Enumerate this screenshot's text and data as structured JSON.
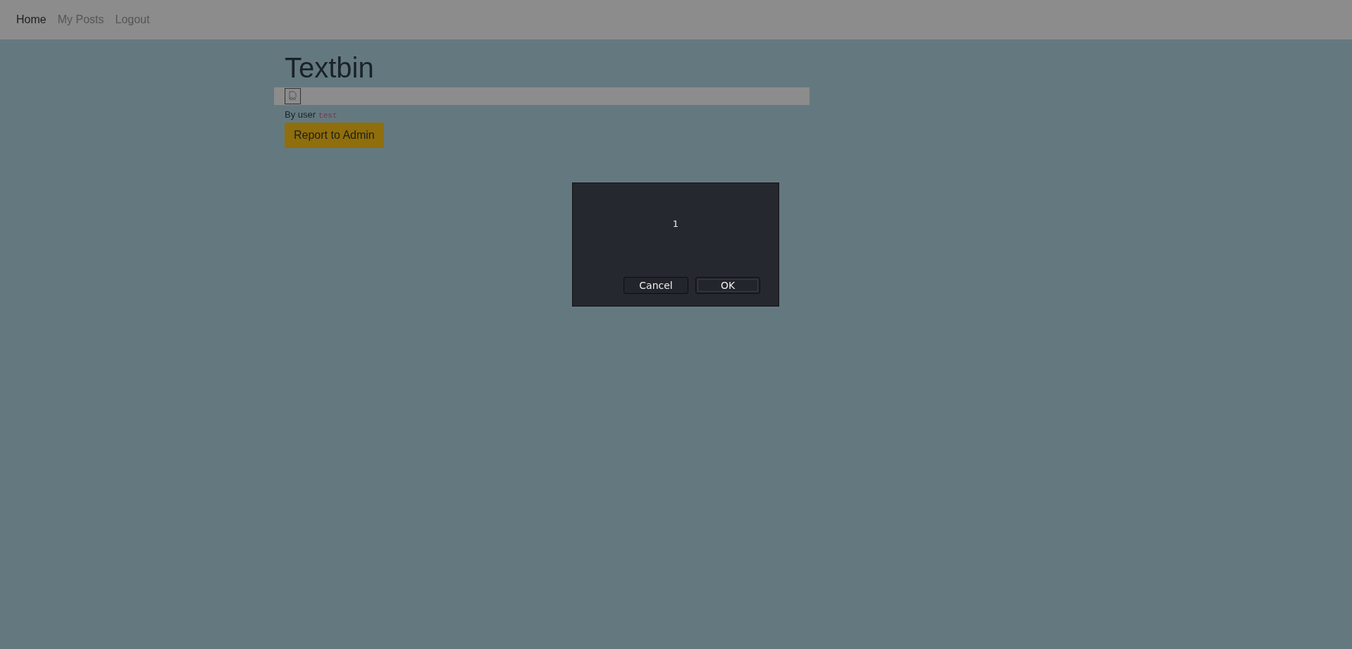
{
  "nav": {
    "items": [
      {
        "label": "Home",
        "selected": true
      },
      {
        "label": "My Posts",
        "selected": false
      },
      {
        "label": "Logout",
        "selected": false
      }
    ]
  },
  "post": {
    "title": "Textbin",
    "author_label": "By user",
    "author": "test",
    "report_button": "Report to Admin"
  },
  "dialog": {
    "message": "1",
    "buttons": [
      {
        "label": "Cancel",
        "selected": false
      },
      {
        "label": "OK",
        "selected": true
      }
    ]
  }
}
